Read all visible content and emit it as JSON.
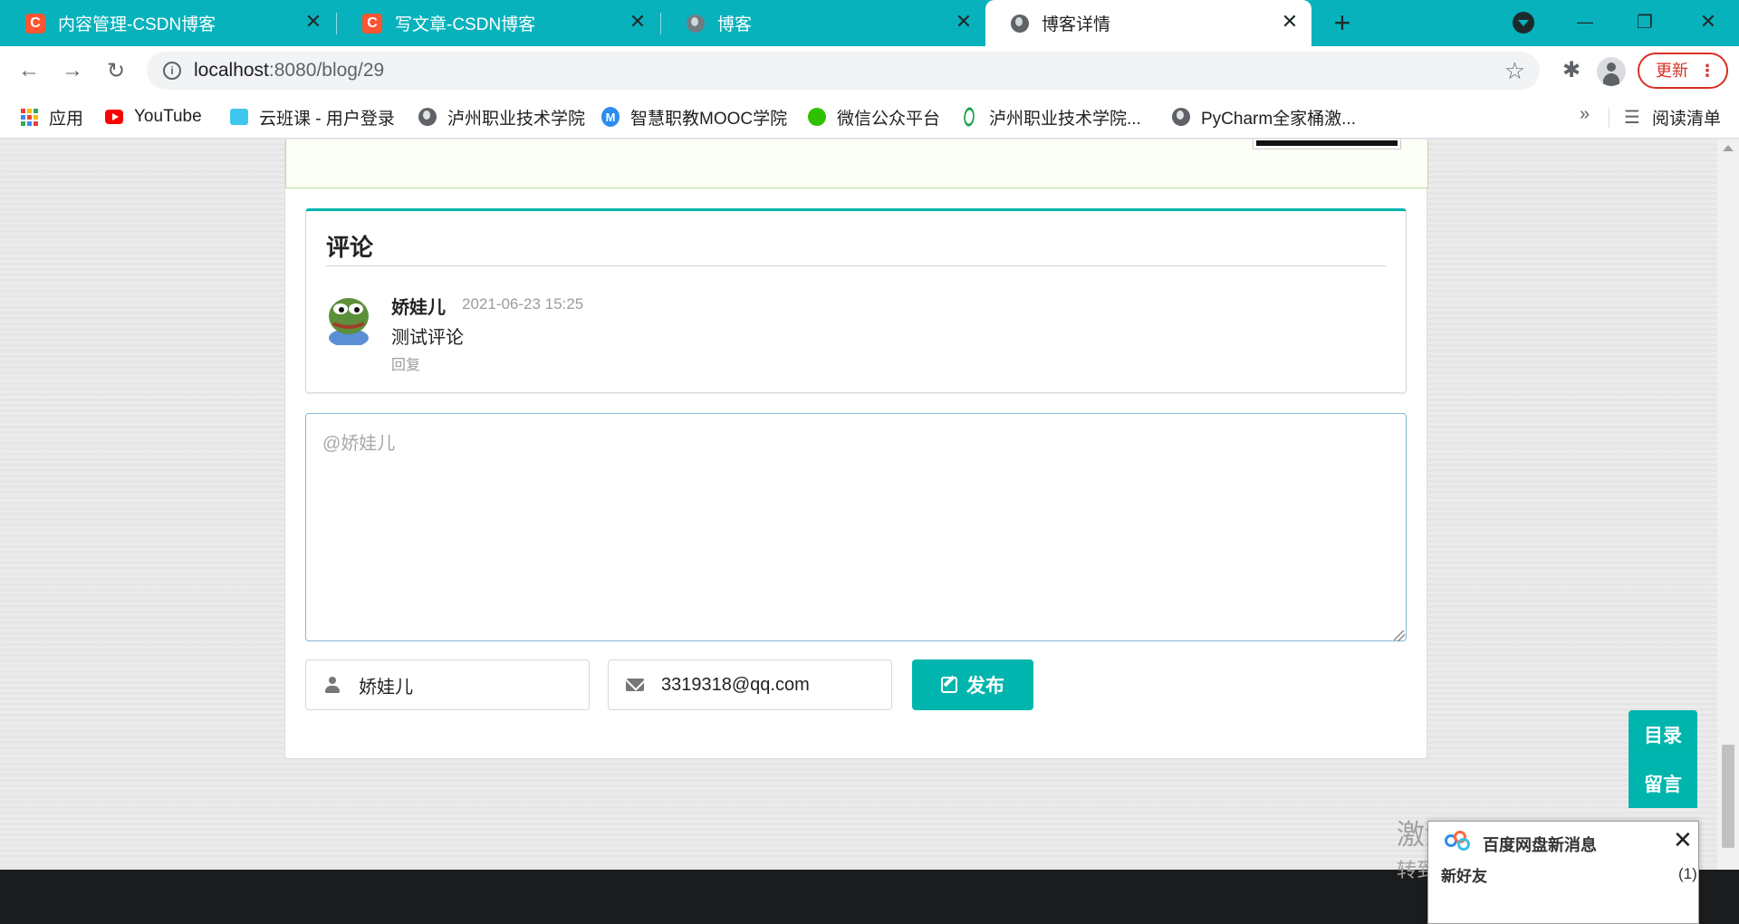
{
  "browser": {
    "tabs": [
      {
        "title": "内容管理-CSDN博客",
        "favicon": "csdn-icon",
        "favicon_text": "C",
        "active": false
      },
      {
        "title": "写文章-CSDN博客",
        "favicon": "csdn-icon",
        "favicon_text": "C",
        "active": false
      },
      {
        "title": "博客",
        "favicon": "globe-icon",
        "active": false
      },
      {
        "title": "博客详情",
        "favicon": "globe-icon",
        "active": true
      }
    ],
    "close_glyph": "✕",
    "new_tab_glyph": "+",
    "window_controls": {
      "minimize": "—",
      "maximize": "❐",
      "close": "✕"
    },
    "address": {
      "host": "localhost",
      "path": ":8080/blog/29",
      "info_glyph": "i"
    },
    "update_label": "更新",
    "update_dots": "⋮",
    "bookmarks": [
      {
        "label": "应用",
        "icon": "apps-grid-icon"
      },
      {
        "label": "YouTube",
        "icon": "youtube-icon"
      },
      {
        "label": "云班课 - 用户登录",
        "icon": "cloud-class-icon"
      },
      {
        "label": "泸州职业技术学院",
        "icon": "globe-icon"
      },
      {
        "label": "智慧职教MOOC学院",
        "icon": "mooc-icon",
        "icon_text": "M"
      },
      {
        "label": "微信公众平台",
        "icon": "wechat-icon"
      },
      {
        "label": "泸州职业技术学院...",
        "icon": "atom-icon"
      },
      {
        "label": "PyCharm全家桶激...",
        "icon": "globe-icon"
      }
    ],
    "bookmarks_more": "»",
    "reading_list": "阅读清单",
    "colors": {
      "tabbar": "#07b2bd",
      "accent": "#00b5ad",
      "update": "#d93025"
    }
  },
  "comments": {
    "heading": "评论",
    "items": [
      {
        "author": "娇娃儿",
        "date": "2021-06-23 15:25",
        "text": "测试评论",
        "reply_label": "回复",
        "avatar": "pepe-frog-avatar"
      }
    ]
  },
  "form": {
    "content_placeholder": "@娇娃儿",
    "nickname_value": "娇娃儿",
    "email_value": "3319318@qq.com",
    "publish_label": "发布"
  },
  "side_tools": {
    "toc_label": "目录",
    "comment_label": "留言"
  },
  "overlays": {
    "activate_line1": "激活 Windows",
    "activate_line2": "转到\"设置\"以激活 Windows。",
    "baidu_title": "百度网盘新消息",
    "baidu_line": "新好友",
    "baidu_count": "(1)",
    "baidu_close": "✕"
  }
}
